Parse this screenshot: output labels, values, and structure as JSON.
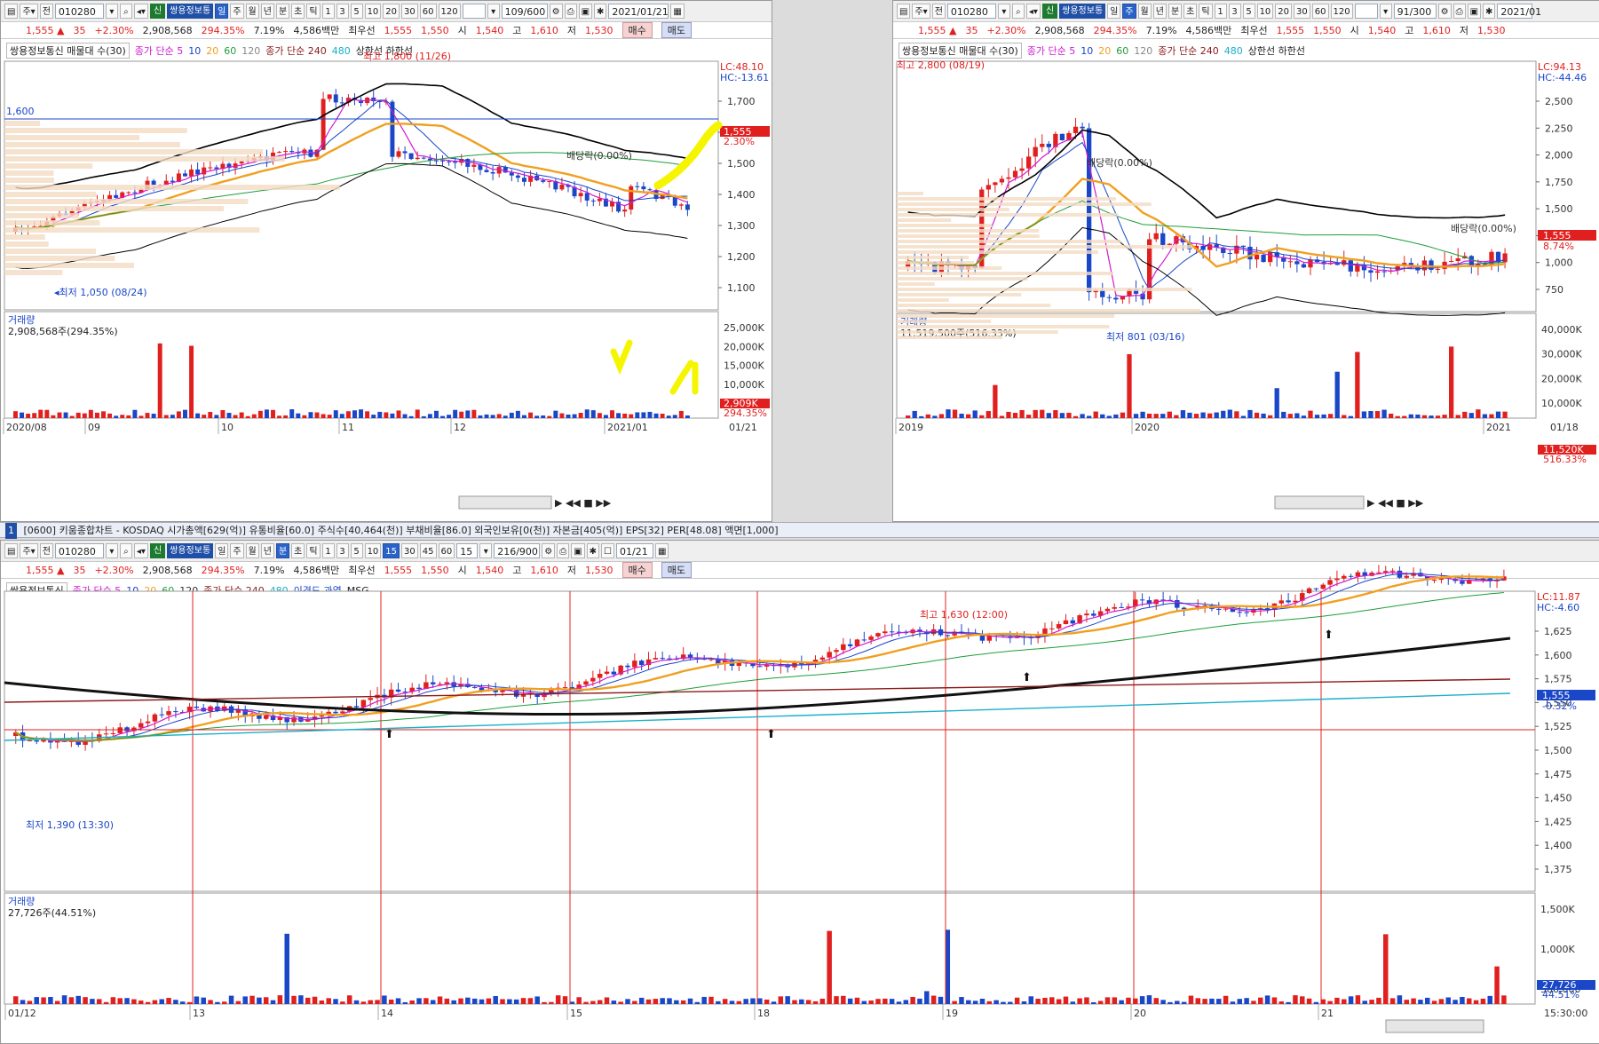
{
  "toolbar_common": {
    "code": "010280",
    "stock_name": "쌍용정보통",
    "period_buttons": [
      "일",
      "주",
      "월",
      "년",
      "분",
      "초",
      "틱"
    ],
    "number_buttons": [
      "1",
      "3",
      "5",
      "10",
      "20",
      "30",
      "60",
      "120"
    ],
    "buy_label": "매수",
    "sell_label": "매도"
  },
  "quote": {
    "price": "1,555",
    "change": "35",
    "change_pct": "+2.30%",
    "volume": "2,908,568",
    "volume_ratio": "294.35%",
    "turnover": "7.19%",
    "trade_value": "4,586백만",
    "best_label": "최우선",
    "best_ask": "1,555",
    "best_bid": "1,550",
    "open_label": "시",
    "open": "1,540",
    "high_label": "고",
    "high": "1,610",
    "low_label": "저",
    "low": "1,530"
  },
  "win_left": {
    "count": "109/600",
    "date": "2021/01/21",
    "active_period": "일",
    "legend": {
      "name": "쌍용정보통신 매물대 수(30)",
      "ma1": "종가 단순 5",
      "ma_10": "10",
      "ma_20": "20",
      "ma_60": "60",
      "ma_120": "120",
      "ma2": "종가 단순 240",
      "ma_480": "480",
      "band": "상한선 하한선"
    },
    "lc": "LC:48.10",
    "hc": "HC:-13.61",
    "high_note": "최고 1,800 (11/26)",
    "low_note": "◂최저 1,050 (08/24)",
    "div_note": "배당락(0.00%)",
    "line_label": "1,600",
    "price_tag": "1,555",
    "price_tag_pct": "2.30%",
    "y_ticks": [
      "1,700",
      "1,600",
      "1,500",
      "1,400",
      "1,300",
      "1,200",
      "1,100"
    ],
    "vol_title": "거래량",
    "vol_value": "2,908,568주(294.35%)",
    "vol_ticks": [
      "25,000K",
      "20,000K",
      "15,000K",
      "10,000K",
      "5,000K"
    ],
    "vol_tag": "2,909K",
    "vol_tag_pct": "294.35%",
    "x_labels": [
      "2020/08",
      "09",
      "10",
      "11",
      "12",
      "2021/01",
      "01/21"
    ]
  },
  "win_right": {
    "count": "91/300",
    "date": "2021/01",
    "active_period": "주",
    "legend": {
      "name": "쌍용정보통신 매물대 수(30)",
      "ma1": "종가 단순 5",
      "ma_10": "10",
      "ma_20": "20",
      "ma_60": "60",
      "ma_120": "120",
      "ma2": "종가 단순 240",
      "ma_480": "480",
      "band": "상한선 하한선"
    },
    "lc": "LC:94.13",
    "hc": "HC:-44.46",
    "high_note": "최고 2,800 (08/19)",
    "low_note": "최저 801 (03/16)",
    "div_note": "배당락(0.00%)",
    "div_note2": "배당락(0.00%)",
    "price_tag": "1,555",
    "price_tag_pct": "8.74%",
    "y_ticks": [
      "2,500",
      "2,250",
      "2,000",
      "1,750",
      "1,500",
      "1,250",
      "1,000",
      "750"
    ],
    "vol_title": "거래량",
    "vol_value": "11,519,500주(516.33%)",
    "vol_ticks": [
      "40,000K",
      "30,000K",
      "20,000K",
      "10,000K"
    ],
    "vol_tag": "11,520K",
    "vol_tag_pct": "516.33%",
    "x_labels": [
      "2019",
      "2020",
      "2021",
      "01/18"
    ]
  },
  "statusbar": {
    "index": "1",
    "text": "[0600] 키움종합차트 - KOSDAQ 시가총액[629(억)] 유통비율[60.0] 주식수[40,464(천)] 부채비율[86.0] 외국인보유[0(천)] 자본금[405(억)] EPS[32] PER[48.08] 액면[1,000]"
  },
  "win_bottom": {
    "count": "216/900",
    "interval": "15",
    "date": "01/21",
    "active_period": "분",
    "active_number": "15",
    "number_buttons": [
      "1",
      "3",
      "5",
      "10",
      "15",
      "30",
      "45",
      "60"
    ],
    "legend": {
      "name": "쌍용정보통신",
      "ma1": "종가 단순 5",
      "ma_10": "10",
      "ma_20": "20",
      "ma_60": "60",
      "ma_120": "120",
      "ma2": "종가 단순 240",
      "ma_480": "480",
      "extra1": "이격도 과열",
      "extra2": "MSG"
    },
    "lc": "LC:11.87",
    "hc": "HC:-4.60",
    "high_note": "최고 1,630 (12:00)",
    "low_note": "최저 1,390 (13:30)",
    "price_tag": "1,555",
    "price_tag_pct": "-0.32%",
    "y_ticks": [
      "1,625",
      "1,600",
      "1,575",
      "1,550",
      "1,525",
      "1,500",
      "1,475",
      "1,450",
      "1,425",
      "1,400",
      "1,375"
    ],
    "vol_title": "거래량",
    "vol_value": "27,726주(44.51%)",
    "vol_ticks": [
      "1,500K",
      "1,000K",
      "500,000"
    ],
    "vol_tag": "27,726",
    "vol_tag_pct": "44.51%",
    "x_labels": [
      "01/12",
      "13",
      "14",
      "15",
      "18",
      "19",
      "20",
      "21",
      "15:30:00"
    ]
  },
  "colors": {
    "up": "#e0201f",
    "down": "#1a46c8",
    "ma5": "#d21ad2",
    "ma10": "#1a46c8",
    "ma20": "#f0a020",
    "ma60": "#1e9e3a",
    "ma240": "#8b1a1a",
    "band": "#000000",
    "highlight": "#f5f500"
  }
}
